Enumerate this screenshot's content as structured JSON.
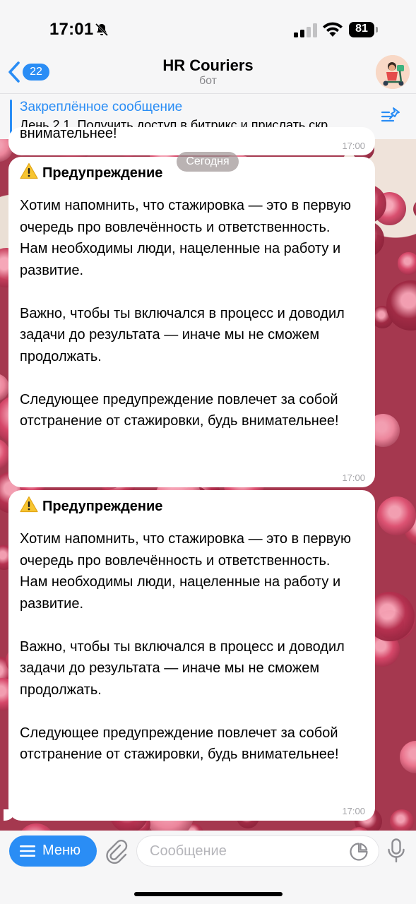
{
  "status_bar": {
    "time": "17:01",
    "battery": "81"
  },
  "header": {
    "back_badge": "22",
    "title": "HR Couriers",
    "subtitle": "бот"
  },
  "pinned": {
    "title": "Закреплённое сообщение",
    "text": "День 2 1. Получить доступ в битрикс и прислать скр..."
  },
  "date_chip": "Сегодня",
  "partial_message": {
    "text": "внимательнее!",
    "time": "17:00"
  },
  "messages": [
    {
      "heading": "Предупреждение",
      "body": "Хотим напомнить, что стажировка — это в первую очередь про вовлечённость и ответственность.\nНам необходимы люди, нацеленные на работу и развитие.\n\nВажно, чтобы ты включался в процесс и доводил задачи до результата — иначе мы не сможем продолжать.\n\nСледующее предупреждение повлечет за собой отстранение от стажировки, будь внимательнее!",
      "time": "17:00"
    },
    {
      "heading": "Предупреждение",
      "body": "Хотим напомнить, что стажировка — это в первую очередь про вовлечённость и ответственность.\nНам необходимы люди, нацеленные на работу и развитие.\n\nВажно, чтобы ты включался в процесс и доводил задачи до результата — иначе мы не сможем продолжать.\n\nСледующее предупреждение повлечет за собой отстранение от стажировки, будь внимательнее!",
      "time": "17:00"
    }
  ],
  "input_bar": {
    "menu_label": "Меню",
    "placeholder": "Сообщение"
  },
  "icons": {
    "status": [
      "bell-slash-icon",
      "signal-icon",
      "wifi-icon",
      "battery-icon"
    ],
    "header": [
      "chevron-left-icon",
      "bot-avatar"
    ],
    "pinned": "pinned-list-icon",
    "message": "warning-icon",
    "input": [
      "hamburger-icon",
      "paperclip-icon",
      "sticker-icon",
      "microphone-icon"
    ]
  },
  "colors": {
    "accent": "#2a8df5",
    "bubble": "#ffffff",
    "chat_background": "#a5384f"
  }
}
